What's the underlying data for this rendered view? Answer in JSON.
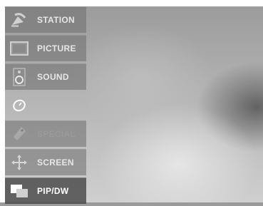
{
  "menu": {
    "items": [
      {
        "label": "STATION",
        "icon": "satellite-dish-icon",
        "state": "normal"
      },
      {
        "label": "PICTURE",
        "icon": "picture-frame-icon",
        "state": "normal"
      },
      {
        "label": "SOUND",
        "icon": "speaker-icon",
        "state": "normal"
      },
      {
        "label": "",
        "icon": "clock-icon",
        "state": "blank"
      },
      {
        "label": "SPECIAL",
        "icon": "tag-icon",
        "state": "disabled"
      },
      {
        "label": "SCREEN",
        "icon": "move-arrows-icon",
        "state": "normal"
      },
      {
        "label": "PIP/DW",
        "icon": "pip-windows-icon",
        "state": "selected"
      }
    ]
  },
  "colors": {
    "menu_bg": "#6e6e6e",
    "selected_bg": "#3c3c3c",
    "label_text": "#e6e6e6",
    "disabled_text": "#9a9a9a"
  }
}
